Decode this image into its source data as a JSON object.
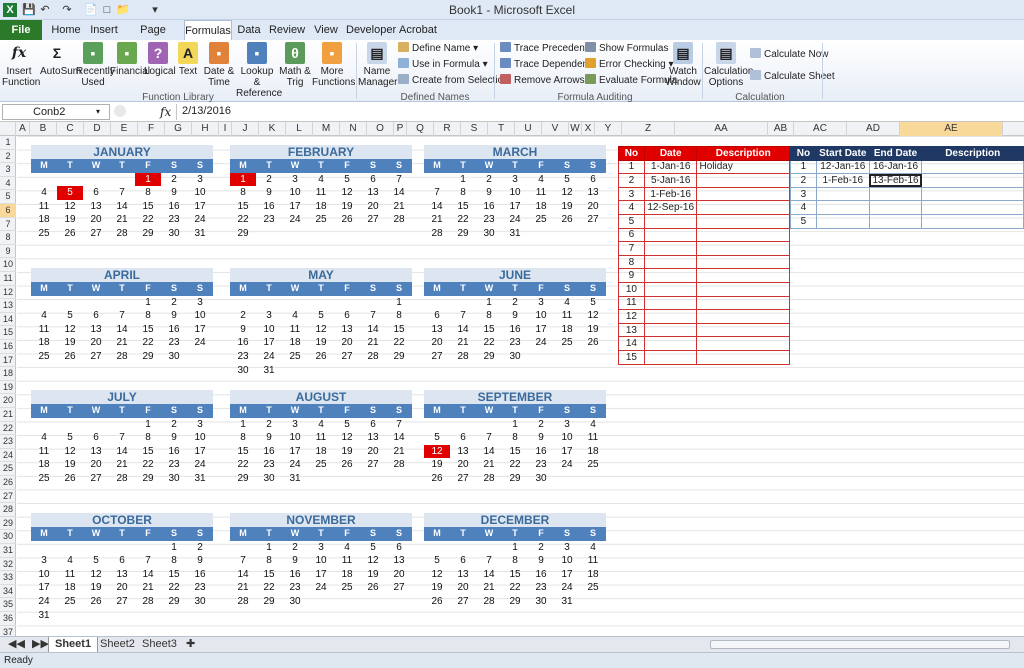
{
  "window": {
    "title": "Book1  -  Microsoft Excel"
  },
  "tabs": [
    "File",
    "Home",
    "Insert",
    "Page Layout",
    "Formulas",
    "Data",
    "Review",
    "View",
    "Developer",
    "Acrobat"
  ],
  "active_tab": "Formulas",
  "ribbon": {
    "function_library": {
      "label": "Function Library",
      "buttons": [
        "Insert Function",
        "AutoSum",
        "Recently Used",
        "Financial",
        "Logical",
        "Text",
        "Date & Time",
        "Lookup & Reference",
        "Math & Trig",
        "More Functions"
      ]
    },
    "defined_names": {
      "label": "Defined Names",
      "name_manager": "Name Manager",
      "define_name": "Define Name",
      "use_in_formula": "Use in Formula",
      "create_from_selection": "Create from Selection"
    },
    "formula_auditing": {
      "label": "Formula Auditing",
      "trace_precedents": "Trace Precedents",
      "trace_dependents": "Trace Dependents",
      "remove_arrows": "Remove Arrows",
      "show_formulas": "Show Formulas",
      "error_checking": "Error Checking",
      "evaluate_formula": "Evaluate Formula",
      "watch_window": "Watch Window"
    },
    "calculation": {
      "label": "Calculation",
      "options": "Calculation Options",
      "calc_now": "Calculate Now",
      "calc_sheet": "Calculate Sheet"
    }
  },
  "formula_bar": {
    "name_box": "Conb2",
    "fx": "fx",
    "value": "2/13/2016"
  },
  "columns": [
    "A",
    "B",
    "C",
    "D",
    "E",
    "F",
    "G",
    "H",
    "I",
    "J",
    "K",
    "L",
    "M",
    "N",
    "O",
    "P",
    "Q",
    "R",
    "S",
    "T",
    "U",
    "V",
    "W",
    "X",
    "Y",
    "Z",
    "AA",
    "AB",
    "AC",
    "AD",
    "AE",
    "AF"
  ],
  "selected_column": "AE",
  "rows": [
    "1",
    "2",
    "3",
    "4",
    "5",
    "6",
    "7",
    "8",
    "9",
    "10",
    "11",
    "12",
    "13",
    "14",
    "15",
    "16",
    "17",
    "18",
    "19",
    "20",
    "21",
    "22",
    "23",
    "24",
    "25",
    "26",
    "27",
    "28",
    "29",
    "30",
    "31",
    "32",
    "33",
    "34",
    "35",
    "36",
    "37",
    "38",
    "39"
  ],
  "selected_row": "6",
  "dow": [
    "M",
    "T",
    "W",
    "T",
    "F",
    "S",
    "S"
  ],
  "months": [
    {
      "name": "JANUARY",
      "weeks": [
        [
          "",
          "",
          "",
          "",
          "1",
          "2",
          "3"
        ],
        [
          "4",
          "5",
          "6",
          "7",
          "8",
          "9",
          "10"
        ],
        [
          "11",
          "12",
          "13",
          "14",
          "15",
          "16",
          "17"
        ],
        [
          "18",
          "19",
          "20",
          "21",
          "22",
          "23",
          "24"
        ],
        [
          "25",
          "26",
          "27",
          "28",
          "29",
          "30",
          "31"
        ]
      ],
      "hl": [
        "1",
        "5"
      ]
    },
    {
      "name": "FEBRUARY",
      "weeks": [
        [
          "1",
          "2",
          "3",
          "4",
          "5",
          "6",
          "7"
        ],
        [
          "8",
          "9",
          "10",
          "11",
          "12",
          "13",
          "14"
        ],
        [
          "15",
          "16",
          "17",
          "18",
          "19",
          "20",
          "21"
        ],
        [
          "22",
          "23",
          "24",
          "25",
          "26",
          "27",
          "28"
        ],
        [
          "29",
          "",
          "",
          "",
          "",
          "",
          ""
        ]
      ],
      "hl": [
        "1"
      ]
    },
    {
      "name": "MARCH",
      "weeks": [
        [
          "",
          "1",
          "2",
          "3",
          "4",
          "5",
          "6"
        ],
        [
          "7",
          "8",
          "9",
          "10",
          "11",
          "12",
          "13"
        ],
        [
          "14",
          "15",
          "16",
          "17",
          "18",
          "19",
          "20"
        ],
        [
          "21",
          "22",
          "23",
          "24",
          "25",
          "26",
          "27"
        ],
        [
          "28",
          "29",
          "30",
          "31",
          "",
          "",
          ""
        ]
      ],
      "hl": []
    },
    {
      "name": "APRIL",
      "weeks": [
        [
          "",
          "",
          "",
          "",
          "1",
          "2",
          "3"
        ],
        [
          "4",
          "5",
          "6",
          "7",
          "8",
          "9",
          "10"
        ],
        [
          "11",
          "12",
          "13",
          "14",
          "15",
          "16",
          "17"
        ],
        [
          "18",
          "19",
          "20",
          "21",
          "22",
          "23",
          "24"
        ],
        [
          "25",
          "26",
          "27",
          "28",
          "29",
          "30",
          ""
        ]
      ],
      "hl": []
    },
    {
      "name": "MAY",
      "weeks": [
        [
          "",
          "",
          "",
          "",
          "",
          "",
          "1"
        ],
        [
          "2",
          "3",
          "4",
          "5",
          "6",
          "7",
          "8"
        ],
        [
          "9",
          "10",
          "11",
          "12",
          "13",
          "14",
          "15"
        ],
        [
          "16",
          "17",
          "18",
          "19",
          "20",
          "21",
          "22"
        ],
        [
          "23",
          "24",
          "25",
          "26",
          "27",
          "28",
          "29"
        ],
        [
          "30",
          "31",
          "",
          "",
          "",
          "",
          ""
        ]
      ],
      "hl": []
    },
    {
      "name": "JUNE",
      "weeks": [
        [
          "",
          "",
          "1",
          "2",
          "3",
          "4",
          "5"
        ],
        [
          "6",
          "7",
          "8",
          "9",
          "10",
          "11",
          "12"
        ],
        [
          "13",
          "14",
          "15",
          "16",
          "17",
          "18",
          "19"
        ],
        [
          "20",
          "21",
          "22",
          "23",
          "24",
          "25",
          "26"
        ],
        [
          "27",
          "28",
          "29",
          "30",
          "",
          "",
          ""
        ]
      ],
      "hl": []
    },
    {
      "name": "JULY",
      "weeks": [
        [
          "",
          "",
          "",
          "",
          "1",
          "2",
          "3"
        ],
        [
          "4",
          "5",
          "6",
          "7",
          "8",
          "9",
          "10"
        ],
        [
          "11",
          "12",
          "13",
          "14",
          "15",
          "16",
          "17"
        ],
        [
          "18",
          "19",
          "20",
          "21",
          "22",
          "23",
          "24"
        ],
        [
          "25",
          "26",
          "27",
          "28",
          "29",
          "30",
          "31"
        ]
      ],
      "hl": []
    },
    {
      "name": "AUGUST",
      "weeks": [
        [
          "1",
          "2",
          "3",
          "4",
          "5",
          "6",
          "7"
        ],
        [
          "8",
          "9",
          "10",
          "11",
          "12",
          "13",
          "14"
        ],
        [
          "15",
          "16",
          "17",
          "18",
          "19",
          "20",
          "21"
        ],
        [
          "22",
          "23",
          "24",
          "25",
          "26",
          "27",
          "28"
        ],
        [
          "29",
          "30",
          "31",
          "",
          "",
          "",
          ""
        ]
      ],
      "hl": []
    },
    {
      "name": "SEPTEMBER",
      "weeks": [
        [
          "",
          "",
          "",
          "1",
          "2",
          "3",
          "4"
        ],
        [
          "5",
          "6",
          "7",
          "8",
          "9",
          "10",
          "11"
        ],
        [
          "12",
          "13",
          "14",
          "15",
          "16",
          "17",
          "18"
        ],
        [
          "19",
          "20",
          "21",
          "22",
          "23",
          "24",
          "25"
        ],
        [
          "26",
          "27",
          "28",
          "29",
          "30",
          "",
          ""
        ]
      ],
      "hl": [
        "12"
      ]
    },
    {
      "name": "OCTOBER",
      "weeks": [
        [
          "",
          "",
          "",
          "",
          "",
          "1",
          "2"
        ],
        [
          "3",
          "4",
          "5",
          "6",
          "7",
          "8",
          "9"
        ],
        [
          "10",
          "11",
          "12",
          "13",
          "14",
          "15",
          "16"
        ],
        [
          "17",
          "18",
          "19",
          "20",
          "21",
          "22",
          "23"
        ],
        [
          "24",
          "25",
          "26",
          "27",
          "28",
          "29",
          "30"
        ],
        [
          "31",
          "",
          "",
          "",
          "",
          "",
          ""
        ]
      ],
      "hl": []
    },
    {
      "name": "NOVEMBER",
      "weeks": [
        [
          "",
          "1",
          "2",
          "3",
          "4",
          "5",
          "6"
        ],
        [
          "7",
          "8",
          "9",
          "10",
          "11",
          "12",
          "13"
        ],
        [
          "14",
          "15",
          "16",
          "17",
          "18",
          "19",
          "20"
        ],
        [
          "21",
          "22",
          "23",
          "24",
          "25",
          "26",
          "27"
        ],
        [
          "28",
          "29",
          "30",
          "",
          "",
          "",
          ""
        ]
      ],
      "hl": []
    },
    {
      "name": "DECEMBER",
      "weeks": [
        [
          "",
          "",
          "",
          "1",
          "2",
          "3",
          "4"
        ],
        [
          "5",
          "6",
          "7",
          "8",
          "9",
          "10",
          "11"
        ],
        [
          "12",
          "13",
          "14",
          "15",
          "16",
          "17",
          "18"
        ],
        [
          "19",
          "20",
          "21",
          "22",
          "23",
          "24",
          "25"
        ],
        [
          "26",
          "27",
          "28",
          "29",
          "30",
          "31",
          ""
        ]
      ],
      "hl": []
    }
  ],
  "holidays": {
    "headers": [
      "No",
      "Date",
      "Description"
    ],
    "rows": [
      [
        "1",
        "1-Jan-16",
        "Holiday"
      ],
      [
        "2",
        "5-Jan-16",
        ""
      ],
      [
        "3",
        "1-Feb-16",
        ""
      ],
      [
        "4",
        "12-Sep-16",
        ""
      ],
      [
        "5",
        "",
        ""
      ],
      [
        "6",
        "",
        ""
      ],
      [
        "7",
        "",
        ""
      ],
      [
        "8",
        "",
        ""
      ],
      [
        "9",
        "",
        ""
      ],
      [
        "10",
        "",
        ""
      ],
      [
        "11",
        "",
        ""
      ],
      [
        "12",
        "",
        ""
      ],
      [
        "13",
        "",
        ""
      ],
      [
        "14",
        "",
        ""
      ],
      [
        "15",
        "",
        ""
      ]
    ]
  },
  "ranges": {
    "headers": [
      "No",
      "Start Date",
      "End Date",
      "Description"
    ],
    "rows": [
      [
        "1",
        "12-Jan-16",
        "16-Jan-16",
        ""
      ],
      [
        "2",
        "1-Feb-16",
        "13-Feb-16",
        ""
      ],
      [
        "3",
        "",
        "",
        ""
      ],
      [
        "4",
        "",
        "",
        ""
      ],
      [
        "5",
        "",
        "",
        ""
      ]
    ]
  },
  "sheets": [
    "Sheet1",
    "Sheet2",
    "Sheet3"
  ],
  "active_sheet": "Sheet1",
  "status": "Ready",
  "colors": {
    "accent_blue": "#4f81bd",
    "holiday_red": "#e00000",
    "navy": "#1f3864"
  }
}
